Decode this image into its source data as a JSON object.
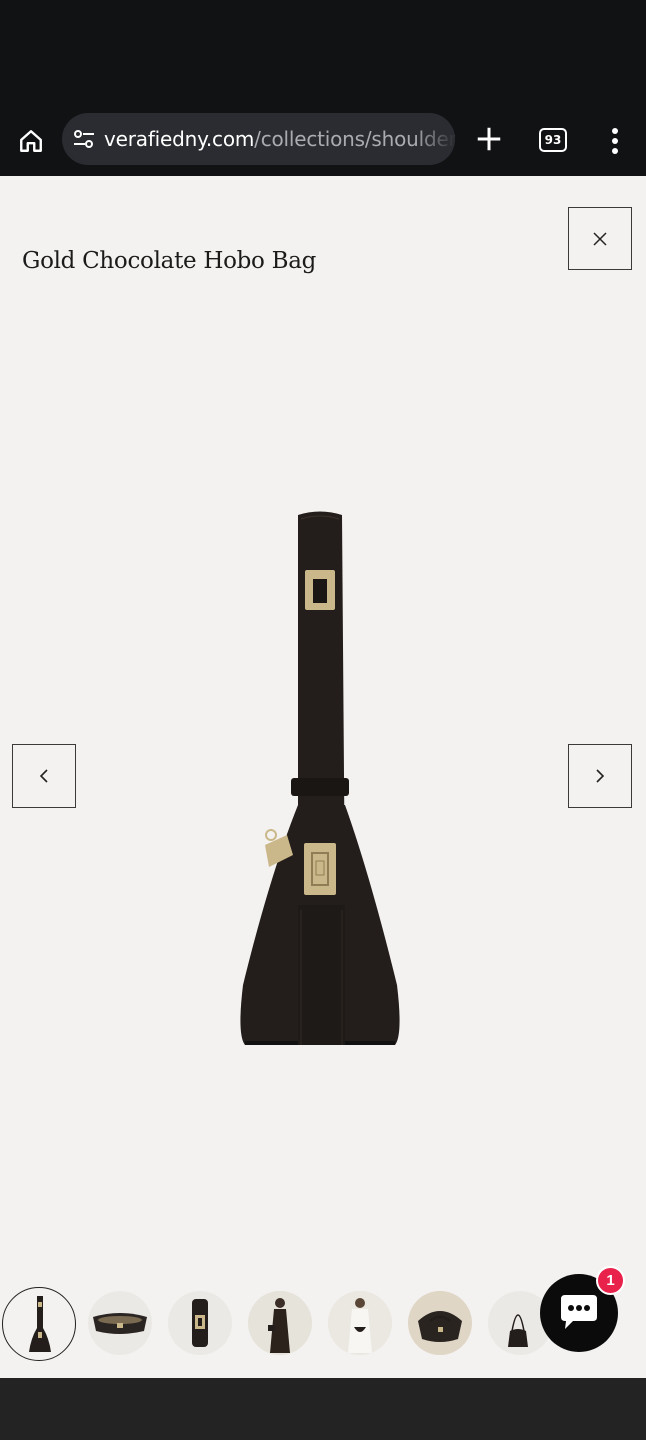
{
  "browser": {
    "url_domain": "verafiedny.com",
    "url_path": "/collections/shoulder-",
    "tab_count": "93",
    "icons": [
      "home-icon",
      "site-settings-icon",
      "plus-icon",
      "tabs-icon",
      "more-vert-icon"
    ]
  },
  "product": {
    "title": "Gold Chocolate Hobo Bag",
    "colors": {
      "leather": "#231e1b",
      "hardware": "#cbb88a",
      "background": "#f3f2f0"
    }
  },
  "gallery": {
    "thumbnails": [
      {
        "name": "bag-side-view",
        "active": true
      },
      {
        "name": "bag-top-view",
        "active": false
      },
      {
        "name": "bag-front-clasp",
        "active": false
      },
      {
        "name": "model-full-length",
        "active": false
      },
      {
        "name": "model-white-outfit",
        "active": false
      },
      {
        "name": "bag-open-tan-lining",
        "active": false
      },
      {
        "name": "bag-handle-hanging",
        "active": false
      }
    ]
  },
  "chat": {
    "badge_count": "1",
    "icon": "chat-icon"
  }
}
